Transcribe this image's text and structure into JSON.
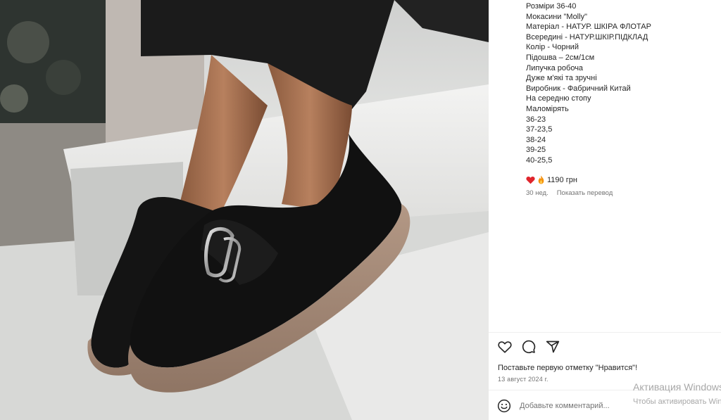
{
  "caption": {
    "lines": [
      "Розміри 36-40",
      "Мокасини \"Molly\"",
      "Матеріал - НАТУР. ШКІРА ФЛОТАР",
      "Всередині - НАТУР.ШКІР.ПІДКЛАД",
      "Колір - Чорний",
      "Підошва – 2см/1см",
      "Липучка робоча",
      "Дуже м'які та зручні",
      "Виробник - Фабричний Китай",
      "На середню стопу",
      "Маломірять",
      "36-23",
      "37-23,5",
      "38-24",
      "39-25",
      "40-25,5"
    ]
  },
  "price": {
    "text": "1190 грн",
    "emoji": [
      "heart-icon",
      "fire-icon"
    ]
  },
  "meta": {
    "age": "30 нед.",
    "translate": "Показать перевод"
  },
  "actions": {
    "icons": [
      "heart-outline-icon",
      "comment-icon",
      "share-icon"
    ]
  },
  "likes_text": "Поставьте первую отметку \"Нравится\"!",
  "date": "13 август 2024 г.",
  "comment": {
    "placeholder": "Добавьте комментарий..."
  },
  "watermark": {
    "title": "Активация Windows",
    "subtitle": "Чтобы активировать Windows"
  },
  "colors": {
    "accent_red": "#e0252c",
    "fire_orange": "#f4900c",
    "muted": "#737373"
  }
}
